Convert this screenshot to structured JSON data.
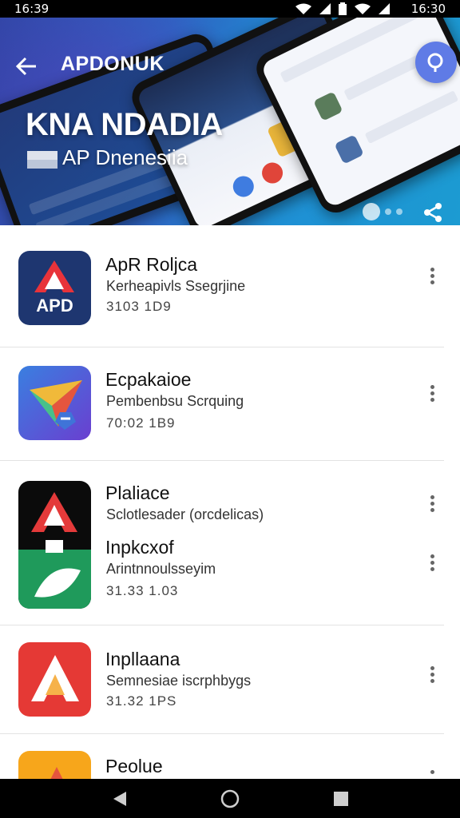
{
  "status_bar": {
    "time_left": "16:39",
    "time_right": "16:30",
    "icons": [
      "wifi-icon",
      "signal-icon",
      "battery-icon",
      "signal-icon"
    ]
  },
  "hero": {
    "app_name": "APDONUK",
    "title": "KNA NDADIA",
    "subtitle": "AP Dnenesiia",
    "colors": {
      "gradient_start": "#3346a8",
      "gradient_end": "#1c9bd2",
      "fab": "#5f7be6"
    }
  },
  "apps": [
    {
      "title": "ApR Roljca",
      "subtitle": "Kerheapivls Ssegrjine",
      "meta": "3103  1D9",
      "icon": "apd-logo-icon",
      "icon_label": "APD"
    },
    {
      "title": "Ecpakaioe",
      "subtitle": "Pembenbsu Scrquing",
      "meta": "70:02  1B9",
      "icon": "paper-plane-icon"
    },
    {
      "title": "Plaliace",
      "subtitle": "Sclotlesader (orcdelicas)",
      "icon": "red-a-icon"
    },
    {
      "title": "Inpkcxof",
      "subtitle": "Arintnnoulsseyim",
      "meta": "31.33  1.03",
      "icon": "green-leaf-icon"
    },
    {
      "title": "Inpllaana",
      "subtitle": "Semnesiae iscrphbygs",
      "meta": "31.32  1PS",
      "icon": "red-triangle-icon"
    },
    {
      "title": "Peolue",
      "icon": "orange-app-icon"
    }
  ],
  "nav": {
    "back": "back-triangle-icon",
    "home": "home-circle-icon",
    "recents": "recents-square-icon"
  }
}
